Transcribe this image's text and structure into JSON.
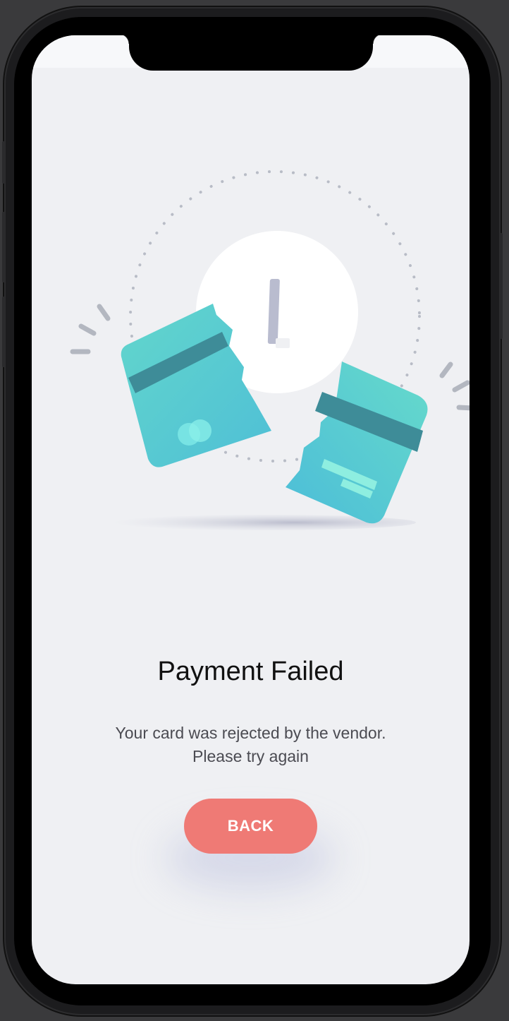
{
  "screen": {
    "title": "Payment Failed",
    "message_line1": "Your card was rejected by the vendor.",
    "message_line2": "Please try again"
  },
  "actions": {
    "back_label": "BACK"
  },
  "illustration": {
    "alert_symbol": "!",
    "icon": "broken-credit-card-icon"
  },
  "colors": {
    "background": "#eff0f3",
    "accent_button": "#ef7a75",
    "card_teal": "#55cbd0",
    "card_stripe": "#3a8a98",
    "alert_mark": "#b9bccf"
  }
}
